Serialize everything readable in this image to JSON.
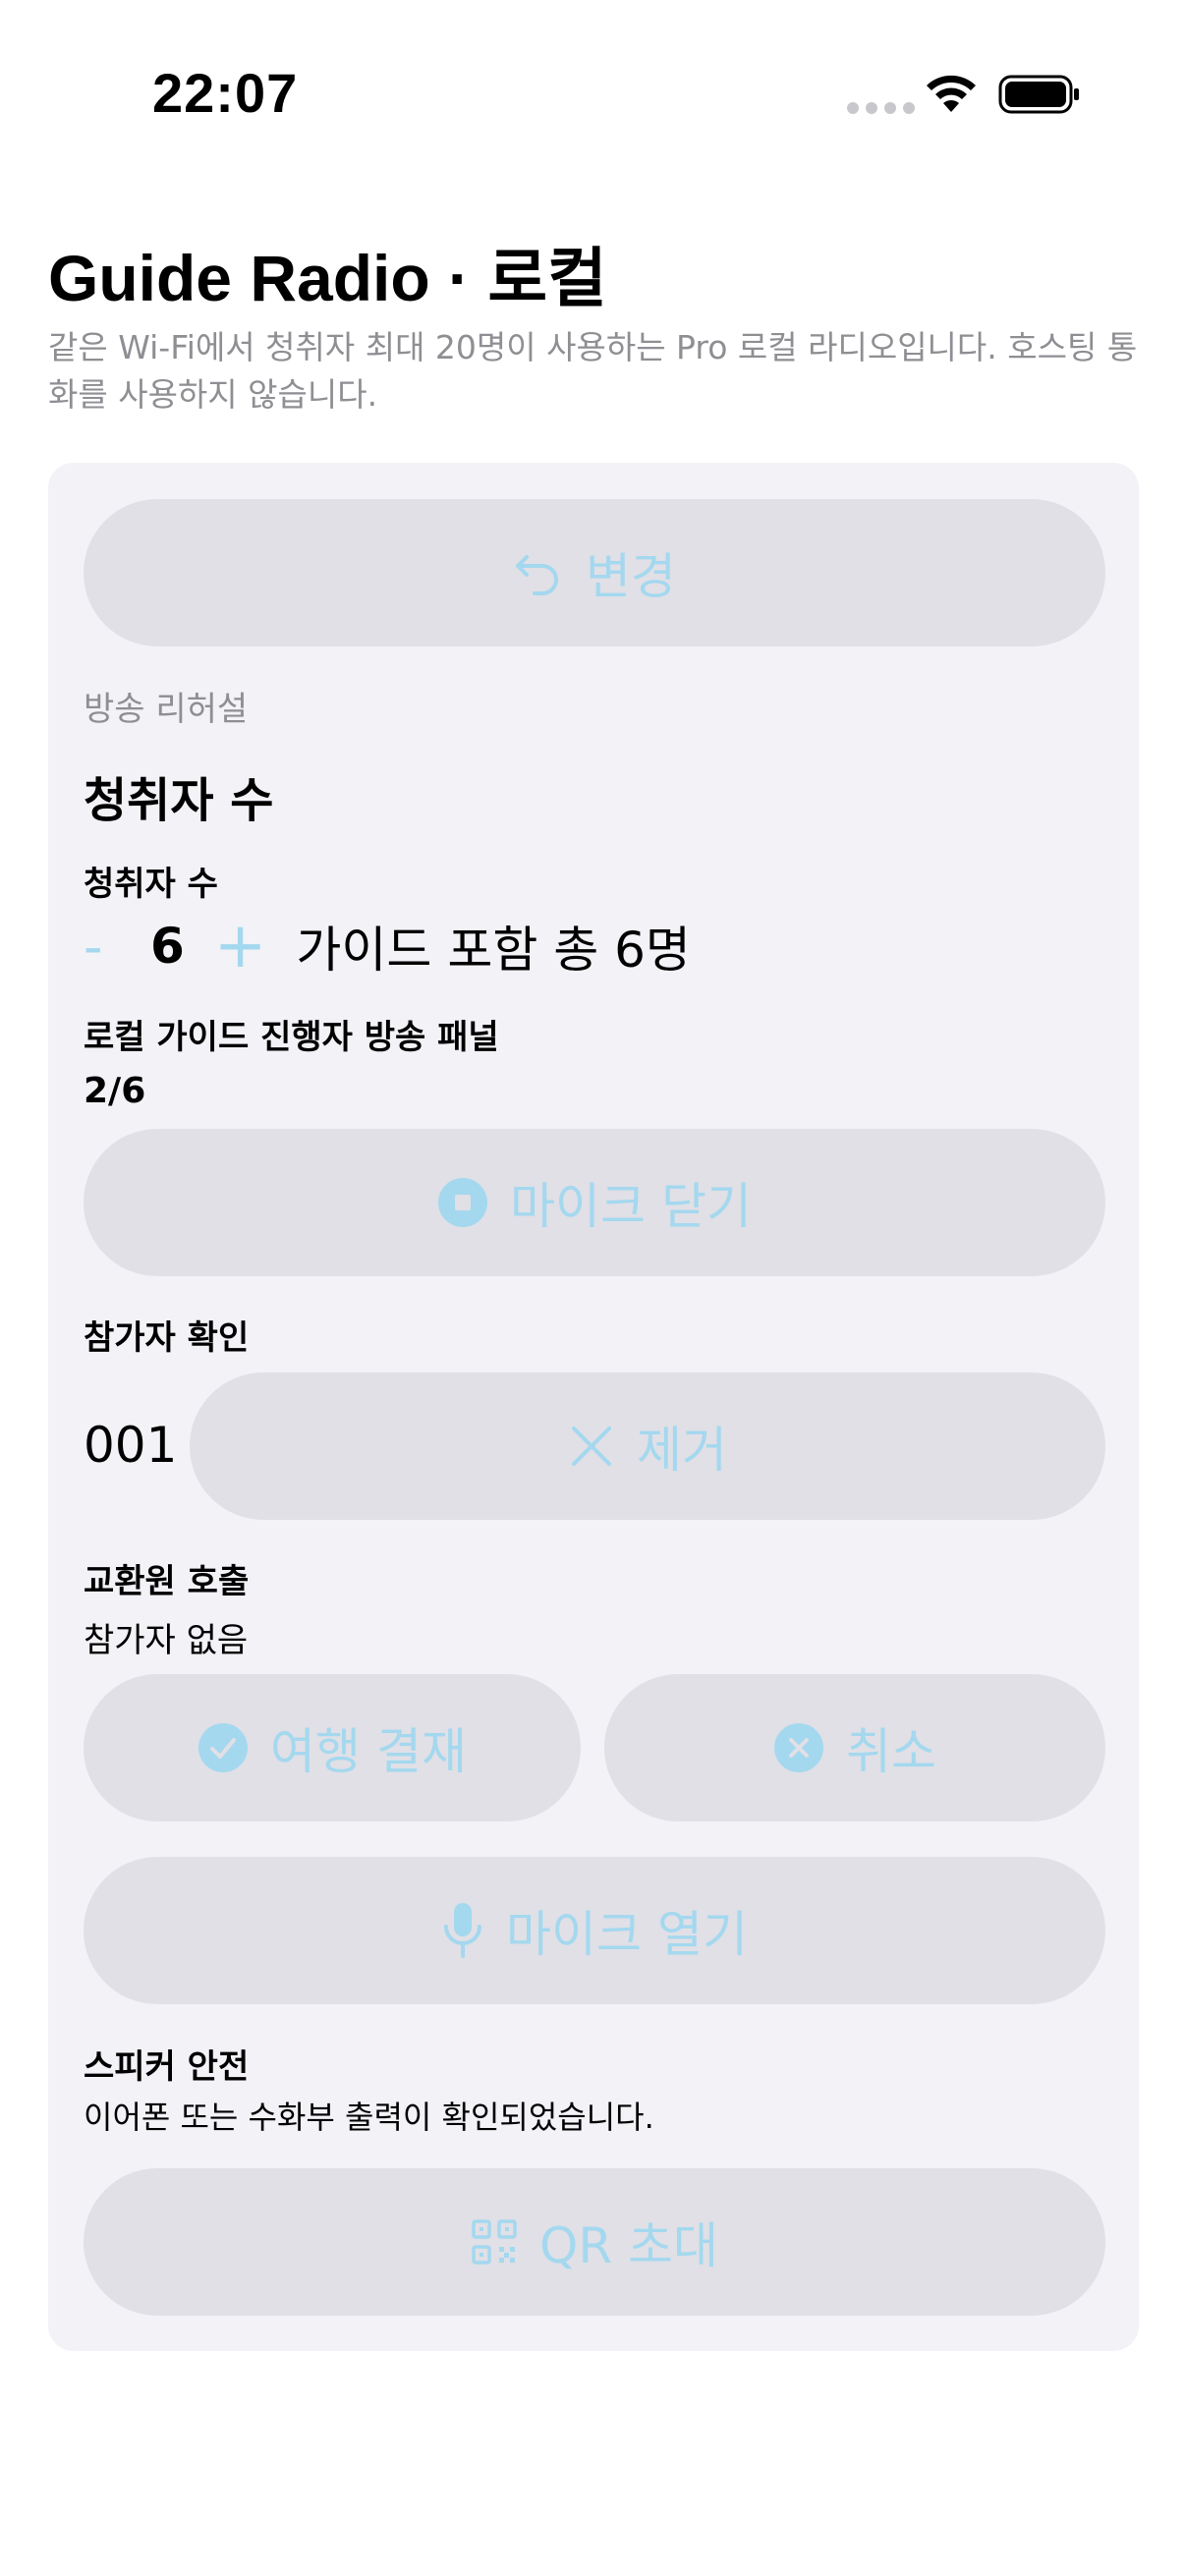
{
  "status_bar": {
    "time": "22:07"
  },
  "header": {
    "title": "Guide Radio · 로컬",
    "subtitle": "같은 Wi-Fi에서 청취자 최대 20명이 사용하는 Pro 로컬 라디오입니다. 호스팅 통화를 사용하지 않습니다."
  },
  "card": {
    "change_button": "변경",
    "rehearsal_label": "방송 리허설",
    "section_title": "청취자 수",
    "listener": {
      "label": "청취자 수",
      "minus": "-",
      "value": "6",
      "plus": "+",
      "total": "가이드 포함 총 6명"
    },
    "panel": {
      "label": "로컬 가이드 진행자 방송 패널",
      "progress": "2/6",
      "close_mic_button": "마이크 닫기"
    },
    "participant": {
      "label": "참가자 확인",
      "id": "001",
      "remove_button": "제거"
    },
    "operator": {
      "label": "교환원 호출",
      "status": "참가자 없음",
      "pay_button": "여행 결재",
      "cancel_button": "취소"
    },
    "open_mic_button": "마이크 열기",
    "speaker": {
      "label": "스피커 안전",
      "status": "이어폰 또는 수화부 출력이 확인되었습니다."
    },
    "qr_button": "QR 초대"
  },
  "colors": {
    "accent_disabled": "#a4d8ef",
    "pill_bg": "#e0e0e6",
    "card_bg": "#f2f2f7",
    "muted_text": "#8e8e93"
  }
}
